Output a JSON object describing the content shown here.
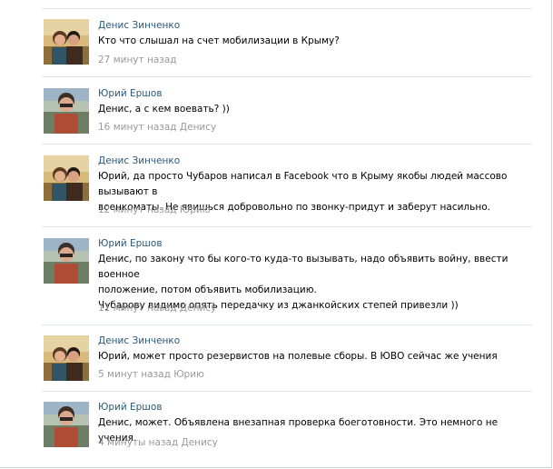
{
  "comments": [
    {
      "author": "Денис Зинченко",
      "avatar_icon": "couple-photo-avatar",
      "text": "Кто что слышал на счет мобилизации в Крыму?",
      "time": "27 минут назад",
      "reply_to": ""
    },
    {
      "author": "Юрий Ершов",
      "avatar_icon": "man-photo-avatar",
      "text": "Денис, а с кем воевать? ))",
      "time": "16 минут назад",
      "reply_to": "Денису"
    },
    {
      "author": "Денис Зинченко",
      "avatar_icon": "couple-photo-avatar",
      "text": "Юрий, да просто Чубаров написал в Facebook что в Крыму якобы людей массово вызывают в\nвоенкоматы. Не явишься добровольно по звонку-придут и заберут насильно.",
      "time": "12 минут назад",
      "reply_to": "Юрию"
    },
    {
      "author": "Юрий Ершов",
      "avatar_icon": "man-photo-avatar",
      "text": "Денис, по закону что бы кого-то куда-то вызывать, надо объявить войну, ввести военное\nположение, потом объявить мобилизацию.\nЧубарову видимо опять передачку из джанкойских степей привезли ))",
      "time": "11 минут назад",
      "reply_to": "Денису"
    },
    {
      "author": "Денис Зинченко",
      "avatar_icon": "couple-photo-avatar",
      "text": "Юрий, может просто резервистов на полевые сборы. В ЮВО сейчас же учения",
      "time": "5 минут назад",
      "reply_to": "Юрию"
    },
    {
      "author": "Юрий Ершов",
      "avatar_icon": "man-photo-avatar",
      "text": "Денис, может. Объявлена внезапная проверка боеготовности. Это немного не учения.",
      "time": "4 минуты назад",
      "reply_to": "Денису"
    }
  ],
  "colors": {
    "author_link": "#2b587a",
    "meta_text": "#999999",
    "separator": "#dfe5eb"
  }
}
